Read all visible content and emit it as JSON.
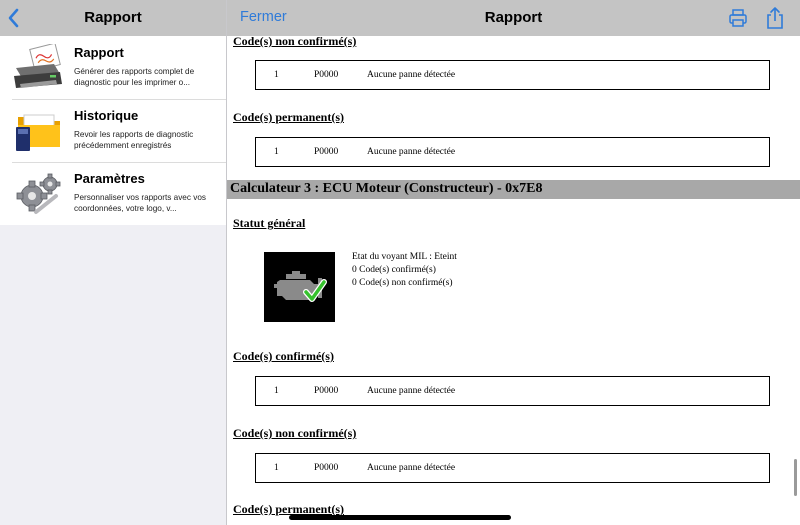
{
  "left_pane": {
    "title": "Rapport",
    "menu": [
      {
        "title": "Rapport",
        "description": "Générer des rapports complet de diagnostic pour les imprimer o...",
        "icon": "printer-report-icon"
      },
      {
        "title": "Historique",
        "description": "Revoir les rapports de diagnostic précédemment enregistrés",
        "icon": "folder-icon"
      },
      {
        "title": "Paramètres",
        "description": "Personnaliser vos rapports avec vos coordonnées, votre logo, v...",
        "icon": "gears-icon"
      }
    ]
  },
  "right_pane": {
    "close_label": "Fermer",
    "title": "Rapport",
    "icons": [
      "printer-icon",
      "share-icon"
    ],
    "accent_color": "#2f7bd9"
  },
  "report": {
    "sections_top": [
      {
        "heading": "Code(s) non confirmé(s)",
        "row": {
          "num": "1",
          "code": "P0000",
          "desc": "Aucune panne détectée"
        }
      },
      {
        "heading": "Code(s) permanent(s)",
        "row": {
          "num": "1",
          "code": "P0000",
          "desc": "Aucune panne détectée"
        }
      }
    ],
    "calculator_title": "Calculateur 3 : ECU Moteur (Constructeur) - 0x7E8",
    "general_status": {
      "heading": "Statut général",
      "mil_status": "Etat du voyant MIL : Eteint",
      "confirmed": "0 Code(s) confirmé(s)",
      "unconfirmed": "0 Code(s) non confirmé(s)",
      "icon": "engine-check-icon"
    },
    "sections_bottom": [
      {
        "heading": "Code(s) confirmé(s)",
        "row": {
          "num": "1",
          "code": "P0000",
          "desc": "Aucune panne détectée"
        }
      },
      {
        "heading": "Code(s) non confirmé(s)",
        "row": {
          "num": "1",
          "code": "P0000",
          "desc": "Aucune panne détectée"
        }
      },
      {
        "heading": "Code(s) permanent(s)"
      }
    ]
  }
}
